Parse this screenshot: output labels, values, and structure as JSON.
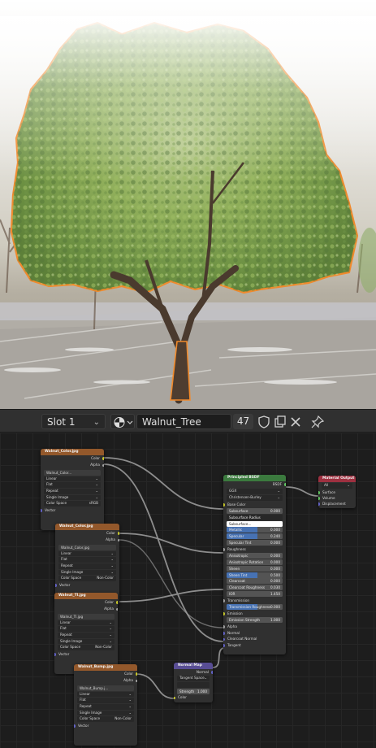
{
  "toolbar": {
    "slot_label": "Slot 1",
    "material_name": "Walnut_Tree",
    "user_count": "47"
  },
  "nodes": {
    "tex1": {
      "title": "Walnut_Color.jpg",
      "out_color": "Color",
      "out_alpha": "Alpha",
      "image": "Walnut_Color...",
      "interp": "Linear",
      "proj": "Flat",
      "ext": "Repeat",
      "source": "Single Image",
      "colorspace_label": "Color Space",
      "colorspace": "sRGB",
      "vector": "Vector"
    },
    "tex2": {
      "title": "Walnut_Color.jpg",
      "out_color": "Color",
      "out_alpha": "Alpha",
      "image": "Walnut_Color.jpg",
      "interp": "Linear",
      "proj": "Flat",
      "ext": "Repeat",
      "source": "Single Image",
      "colorspace_label": "Color Space",
      "colorspace": "Non-Color",
      "vector": "Vector"
    },
    "tex3": {
      "title": "Walnut_Tl.jpg",
      "out_color": "Color",
      "out_alpha": "Alpha",
      "image": "Walnut_Tl.jpg",
      "interp": "Linear",
      "proj": "Flat",
      "ext": "Repeat",
      "source": "Single Image",
      "colorspace_label": "Color Space",
      "colorspace": "Non-Color",
      "vector": "Vector"
    },
    "tex4": {
      "title": "Walnut_Bump.jpg",
      "out_color": "Color",
      "out_alpha": "Alpha",
      "image": "Walnut_Bump.j...",
      "interp": "Linear",
      "proj": "Flat",
      "ext": "Repeat",
      "source": "Single Image",
      "colorspace_label": "Color Space",
      "colorspace": "Non-Color",
      "vector": "Vector"
    },
    "bsdf": {
      "title": "Principled BSDF",
      "out": "BSDF",
      "dist": "GGX",
      "sss": "Christensen-Burley",
      "rows": [
        {
          "label": "Base Color",
          "value": ""
        },
        {
          "label": "Subsurface",
          "value": "0.000"
        },
        {
          "label": "Subsurface Radius",
          "value": ""
        },
        {
          "label": "Subsurface...",
          "value": ""
        },
        {
          "label": "Metallic",
          "value": "0.000"
        },
        {
          "label": "Specular",
          "value": "0.240"
        },
        {
          "label": "Specular Tint",
          "value": "0.000"
        },
        {
          "label": "Roughness",
          "value": ""
        },
        {
          "label": "Anisotropic",
          "value": "0.000"
        },
        {
          "label": "Anisotropic Rotation",
          "value": "0.000"
        },
        {
          "label": "Sheen",
          "value": "0.000"
        },
        {
          "label": "Sheen Tint",
          "value": "0.500"
        },
        {
          "label": "Clearcoat",
          "value": "0.000"
        },
        {
          "label": "Clearcoat Roughness",
          "value": "0.030"
        },
        {
          "label": "IOR",
          "value": "1.450"
        },
        {
          "label": "Transmission",
          "value": ""
        },
        {
          "label": "Transmission Roughness",
          "value": "0.000"
        },
        {
          "label": "Emission",
          "value": ""
        },
        {
          "label": "Emission Strength",
          "value": "1.000"
        },
        {
          "label": "Alpha",
          "value": ""
        },
        {
          "label": "Normal",
          "value": ""
        },
        {
          "label": "Clearcoat Normal",
          "value": ""
        },
        {
          "label": "Tangent",
          "value": ""
        }
      ]
    },
    "output": {
      "title": "Material Output",
      "target": "All",
      "surface": "Surface",
      "volume": "Volume",
      "displacement": "Displacement"
    },
    "bump": {
      "title": "Normal Map",
      "out": "Normal",
      "space": "Tangent Space",
      "uv": "",
      "strength_label": "Strength",
      "strength": "1.000",
      "color": "Color"
    }
  },
  "colors": {
    "texture_header": "#93582b",
    "shader_header": "#3b7a3e",
    "output_header": "#9e3040",
    "vector_header": "#584d94",
    "selection_outline": "#f08a2c"
  }
}
